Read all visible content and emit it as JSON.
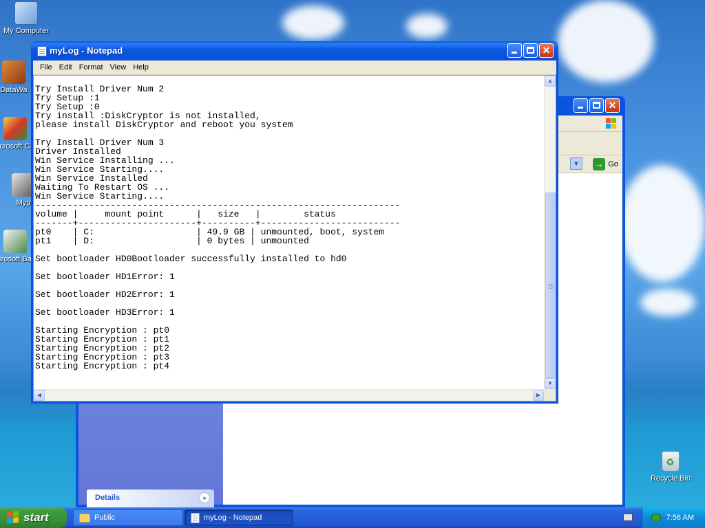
{
  "desktop": {
    "icons": [
      {
        "label": "My Computer",
        "icon": "computer-icon"
      },
      {
        "label": "DataWa",
        "icon": "shortcut-icon"
      },
      {
        "label": "Microsoft C++",
        "icon": "shortcut-icon"
      },
      {
        "label": "Myp",
        "icon": "shortcut-icon"
      },
      {
        "label": "Microsoft Basic",
        "icon": "shortcut-icon"
      }
    ],
    "recycle_bin": {
      "label": "Recycle Bin",
      "icon": "recycle-bin-icon"
    }
  },
  "explorer": {
    "go_label": "Go",
    "details_label": "Details"
  },
  "notepad": {
    "title": "myLog - Notepad",
    "menu": [
      "File",
      "Edit",
      "Format",
      "View",
      "Help"
    ],
    "lines": [
      "Try Install Driver Num 2",
      "Try Setup :1",
      "Try Setup :0",
      "Try install :DiskCryptor is not installed,",
      "please install DiskCryptor and reboot you system",
      "",
      "Try Install Driver Num 3",
      "Driver Installed",
      "Win Service Installing ...",
      "Win Service Starting....",
      "Win Service Installed",
      "Waiting To Restart OS ...",
      "Win Service Starting....",
      "--------------------------------------------------------------------",
      "volume |     mount point      |   size   |        status",
      "-------+----------------------+----------+--------------------------",
      "pt0    | C:                   | 49.9 GB | unmounted, boot, system",
      "pt1    | D:                   | 0 bytes | unmounted",
      "",
      "Set bootloader HD0Bootloader successfully installed to hd0",
      "",
      "Set bootloader HD1Error: 1",
      "",
      "Set bootloader HD2Error: 1",
      "",
      "Set bootloader HD3Error: 1",
      "",
      "Starting Encryption : pt0",
      "Starting Encryption : pt1",
      "Starting Encryption : pt2",
      "Starting Encryption : pt3",
      "Starting Encryption : pt4"
    ]
  },
  "taskbar": {
    "start_label": "start",
    "tasks": [
      {
        "label": "Public",
        "icon": "folder-icon",
        "active": false
      },
      {
        "label": "myLog - Notepad",
        "icon": "notepad-icon",
        "active": true
      }
    ],
    "clock": "7:56 AM"
  },
  "colors": {
    "title_bar": "#0a54e0",
    "start_green": "#3c9b3c",
    "tray_blue": "#0f8ad8",
    "menu_bg": "#ece9d8"
  }
}
